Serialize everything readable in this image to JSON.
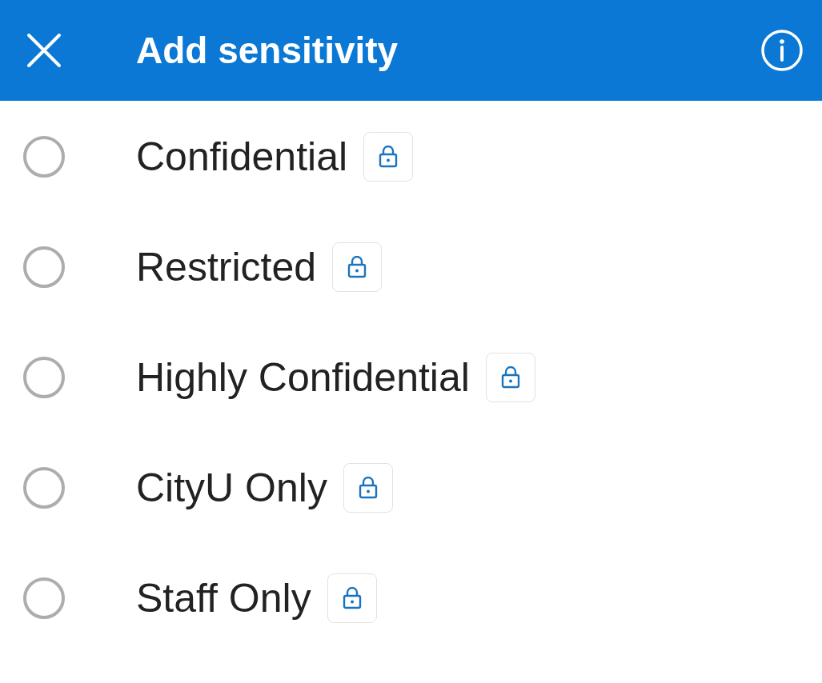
{
  "header": {
    "title": "Add sensitivity"
  },
  "options": [
    {
      "label": "Confidential",
      "selected": false,
      "locked": true
    },
    {
      "label": "Restricted",
      "selected": false,
      "locked": true
    },
    {
      "label": "Highly Confidential",
      "selected": false,
      "locked": true
    },
    {
      "label": "CityU Only",
      "selected": false,
      "locked": true
    },
    {
      "label": "Staff Only",
      "selected": false,
      "locked": true
    }
  ]
}
